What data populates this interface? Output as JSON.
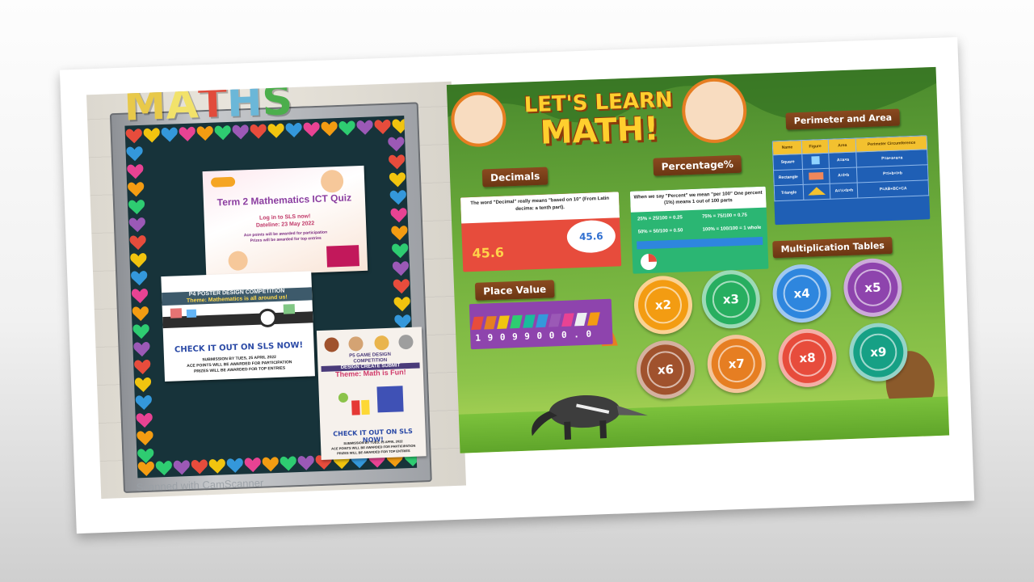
{
  "left_photo": {
    "board_letters": [
      "M",
      "A",
      "T",
      "H",
      "S"
    ],
    "letter_colors": [
      "#e8c94a",
      "#f2e26a",
      "#e14b3b",
      "#6bb7d8",
      "#4cae4c"
    ],
    "quiz_poster": {
      "title": "Term 2 Mathematics ICT Quiz",
      "line1": "Log in to SLS now!",
      "line2": "Dateline: 23 May 2022",
      "line3": "Ace points will be awarded for participation",
      "line4": "Prizes will be awarded for top entries"
    },
    "p4_poster": {
      "header1": "P4 POSTER DESIGN COMPETITION",
      "header2": "Theme: Mathematics is all around us!",
      "cta": "CHECK IT OUT ON SLS NOW!",
      "submission": "SUBMISSION BY TUES, 25 APRIL 2022",
      "note1": "ACE POINTS WILL BE AWARDED FOR PARTICIPATION",
      "note2": "PRIZES WILL BE AWARDED FOR TOP ENTRIES"
    },
    "p5_poster": {
      "header1": "P5 GAME DESIGN",
      "header2": "COMPETITION",
      "header3": "DESIGN CREATE SUBMIT",
      "theme": "Theme: Math is Fun!",
      "cta": "CHECK IT OUT ON SLS NOW!",
      "submission": "SUBMISSION BY TUES, 25 APRIL 2022",
      "note1": "ACE POINTS WILL BE AWARDED FOR PARTICIPATION",
      "note2": "PRIZES WILL BE AWARDED FOR TOP ENTRIES"
    },
    "watermark": "Scanned with CamScanner"
  },
  "right_poster": {
    "title_line1": "LET'S LEARN",
    "title_line2": "MATH!",
    "decimals": {
      "heading": "Decimals",
      "intro": "The word \"Decimal\" really means \"based on 10\" (From Latin decima: a tenth part).",
      "example": "45.6",
      "bubble": "45.6"
    },
    "percentage": {
      "heading": "Percentage%",
      "intro": "When we say \"Percent\" we mean \"per 100\" One percent (1%) means 1 out of 100 parts",
      "rows": [
        "25% = 25/100 = 0.25",
        "75% = 75/100 = 0.75",
        "50% = 50/100 = 0.50",
        "100% = 100/100 = 1 whole"
      ]
    },
    "place_value": {
      "heading": "Place Value",
      "digits": "1 9 0 9 9 0 0 0 . 0"
    },
    "perimeter": {
      "heading": "Perimeter and Area",
      "columns": [
        "Name",
        "Figure",
        "Area",
        "Perimeter Circumference"
      ],
      "rows": [
        [
          "Square",
          "",
          "A=a×a",
          "P=a+a+a+a"
        ],
        [
          "Rectangle",
          "",
          "A=l×b",
          "P=l+b+l+b"
        ],
        [
          "Triangle",
          "",
          "A=½×b×h",
          "P=AB+BC+CA"
        ]
      ]
    },
    "multiplication": {
      "heading": "Multiplication Tables",
      "tables": [
        "x2",
        "x3",
        "x4",
        "x5",
        "x6",
        "x7",
        "x8",
        "x9"
      ],
      "colors": [
        "#f39c12",
        "#27ae60",
        "#2e86de",
        "#8e44ad",
        "#a0522d",
        "#e67e22",
        "#e74c3c",
        "#16a085"
      ]
    }
  }
}
